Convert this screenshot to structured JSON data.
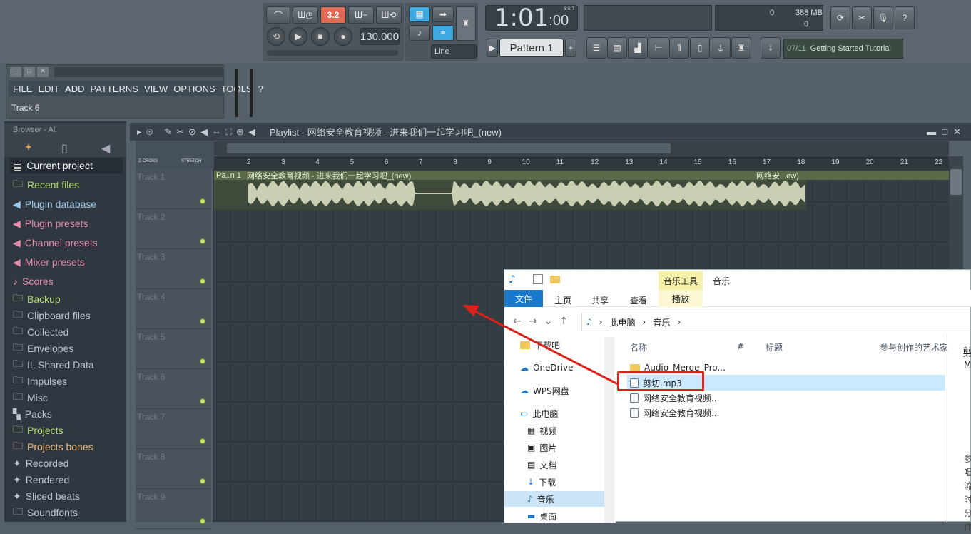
{
  "transport": {
    "time": "1:01",
    "time_frac": ":00",
    "bst_label": "B:S:T",
    "tempo": "130.000",
    "pattern": "Pattern 1",
    "snap": "Line",
    "mode_lcd": "3.2"
  },
  "cpu": {
    "num1": "0",
    "mem": "388 MB",
    "num2": "0"
  },
  "tutorial": {
    "step": "07/11",
    "label": "Getting Started Tutorial"
  },
  "menu": [
    "FILE",
    "EDIT",
    "ADD",
    "PATTERNS",
    "VIEW",
    "OPTIONS",
    "TOOLS",
    "?"
  ],
  "hint": "Track 6",
  "browser": {
    "header": "Browser - All",
    "items": [
      "Current project",
      "Recent files",
      "Plugin database",
      "Plugin presets",
      "Channel presets",
      "Mixer presets",
      "Scores",
      "Backup",
      "Clipboard files",
      "Collected",
      "Envelopes",
      "IL Shared Data",
      "Impulses",
      "Misc",
      "Packs",
      "Projects",
      "Projects bones",
      "Recorded",
      "Rendered",
      "Sliced beats",
      "Soundfonts"
    ]
  },
  "playlist": {
    "title": "Playlist - 网络安全教育视频 - 进来我们一起学习吧_(new)",
    "zcross": "Z-CROSS",
    "stretch": "STRETCH",
    "clip_prefix": "Pa..n 1",
    "clip_name": "网络安全教育视频 - 进来我们一起学习吧_(new)",
    "clip_right": "网络安...ew)",
    "ruler": [
      "2",
      "3",
      "4",
      "5",
      "6",
      "7",
      "8",
      "9",
      "10",
      "11",
      "12",
      "13",
      "14",
      "15",
      "16",
      "17",
      "18",
      "19",
      "20",
      "21",
      "22"
    ],
    "tracks": [
      "Track 1",
      "Track 2",
      "Track 3",
      "Track 4",
      "Track 5",
      "Track 6",
      "Track 7",
      "Track 8",
      "Track 9"
    ]
  },
  "explorer": {
    "ribbon_tabs": [
      "文件",
      "主页",
      "共享",
      "查看"
    ],
    "context_tab": "音乐工具",
    "context_sub": "播放",
    "window_title": "音乐",
    "breadcrumb": [
      "此电脑",
      "音乐"
    ],
    "columns": [
      "名称",
      "#",
      "标题",
      "参与创作的艺术家"
    ],
    "nav": [
      "下载吧",
      "OneDrive",
      "WPS网盘",
      "此电脑",
      "视频",
      "图片",
      "文档",
      "下载",
      "音乐",
      "桌面"
    ],
    "files": [
      "Audio_Merge_Pro...",
      "剪切.mp3",
      "网络安全教育视频...",
      "网络安全教育视频..."
    ],
    "detail_title_partial": "剪",
    "detail_sub_partial": "M",
    "detail_side": [
      "参",
      "唱",
      "流",
      "时",
      "分",
      "作"
    ]
  }
}
